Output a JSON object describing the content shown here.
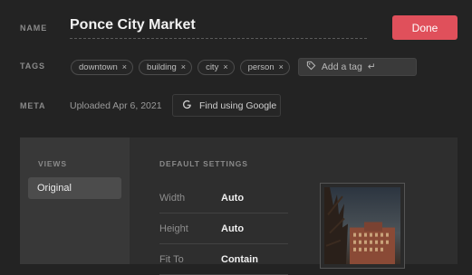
{
  "header": {
    "name_label": "NAME",
    "title": "Ponce City Market",
    "done_label": "Done"
  },
  "tags": {
    "label": "TAGS",
    "items": [
      "downtown",
      "building",
      "city",
      "person"
    ],
    "remove_glyph": "×",
    "add_placeholder": "Add a tag",
    "enter_glyph": "↵"
  },
  "meta": {
    "label": "META",
    "uploaded": "Uploaded Apr 6, 2021",
    "google_button": "Find using Google"
  },
  "views": {
    "label": "VIEWS",
    "items": [
      "Original"
    ]
  },
  "settings": {
    "label": "DEFAULT SETTINGS",
    "rows": [
      {
        "name": "Width",
        "value": "Auto"
      },
      {
        "name": "Height",
        "value": "Auto"
      },
      {
        "name": "Fit To",
        "value": "Contain"
      }
    ]
  },
  "colors": {
    "accent": "#e0505b",
    "background": "#232323",
    "panel": "#2e2e2e"
  },
  "icons": {
    "tag": "tag-icon",
    "google": "google-icon",
    "remove": "close-icon",
    "enter": "enter-icon"
  }
}
